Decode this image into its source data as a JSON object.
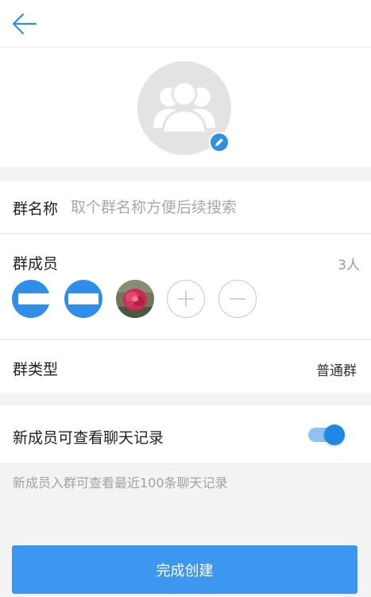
{
  "header": {
    "back_icon": "arrow-left-icon",
    "accent": "#2f8fe8"
  },
  "avatar": {
    "icon": "group-people-icon",
    "edit_icon": "pencil-icon"
  },
  "group_name": {
    "label": "群名称",
    "value": "",
    "placeholder": "取个群名称方便后续搜索"
  },
  "members": {
    "label": "群成员",
    "count": "3人",
    "items": [
      {
        "type": "avatar",
        "color": "#2f8fe8"
      },
      {
        "type": "avatar",
        "color": "#2f8fe8"
      },
      {
        "type": "photo",
        "subject": "red flower"
      }
    ],
    "add_icon": "plus-circle-icon",
    "remove_icon": "minus-circle-icon"
  },
  "group_type": {
    "label": "群类型",
    "value": "普通群"
  },
  "history": {
    "label": "新成员可查看聊天记录",
    "toggle_on": true,
    "hint": "新成员入群可查看最近100条聊天记录"
  },
  "submit": {
    "label": "完成创建",
    "color": "#3d96f0"
  }
}
